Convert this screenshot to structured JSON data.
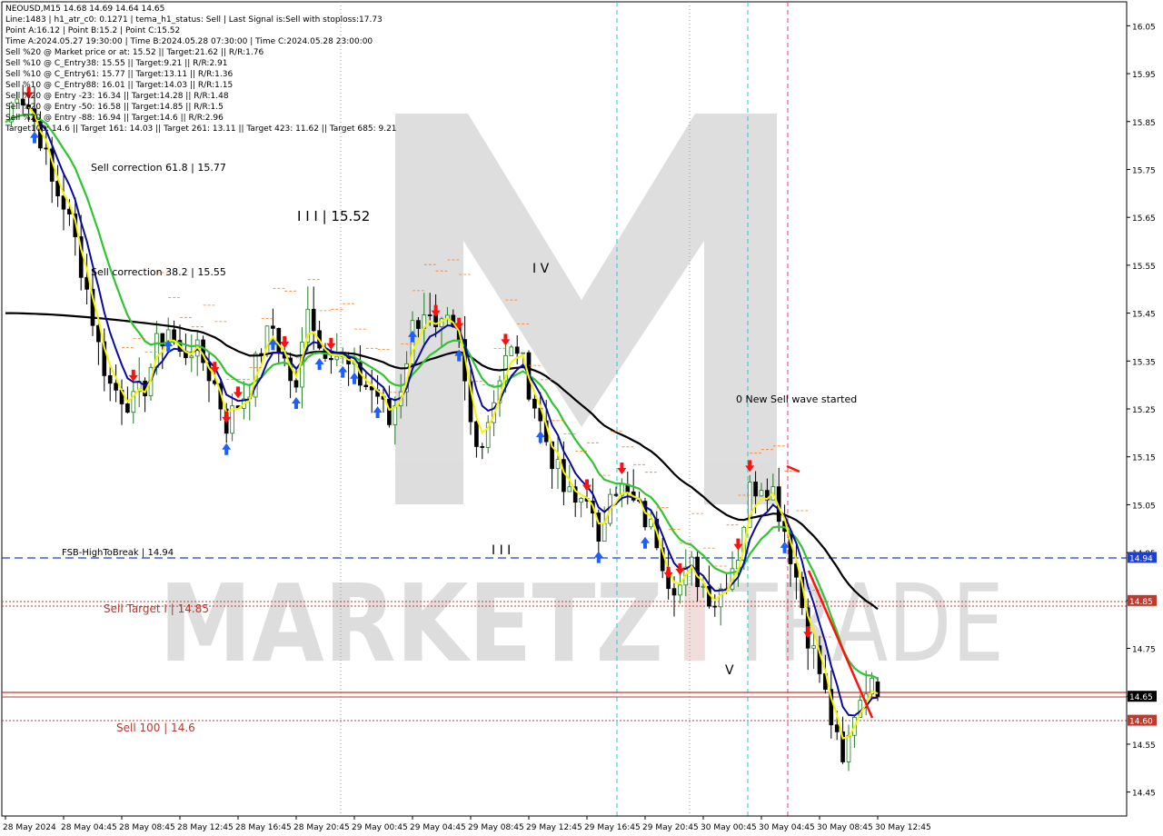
{
  "header": {
    "lines": [
      "NEOUSD,M15  14.68 14.69 14.64 14.65",
      "Line:1483  |  h1_atr_c0: 0.1271  |  tema_h1_status: Sell  |  Last Signal is:Sell with stoploss:17.73",
      "Point A:16.12  |  Point B:15.2  |  Point C:15.52",
      "Time A:2024.05.27 19:30:00  |  Time B:2024.05.28 07:30:00  |  Time C:2024.05.28 23:00:00",
      "Sell %20 @ Market price or at: 15.52  ||  Target:21.62  ||  R/R:1.76",
      "Sell %10 @ C_Entry38: 15.55  ||  Target:9.21  ||  R/R:2.91",
      "Sell %10 @ C_Entry61: 15.77  ||  Target:13.11  ||  R/R:1.36",
      "Sell %10 @ C_Entry88: 16.01  ||  Target:14.03  ||  R/R:1.15",
      "Sell %20 @ Entry -23: 16.34  ||  Target:14.28  ||  R/R:1.48",
      "Sell %20 @ Entry -50: 16.58  ||  Target:14.85  ||  R/R:1.5",
      "Sell %20 @ Entry -88: 16.94  ||  Target:14.6  ||  R/R:2.96",
      "Target100: 14.6  ||  Target 161: 14.03  ||  Target 261: 13.11  ||  Target 423: 11.62  ||  Target 685: 9.21"
    ]
  },
  "watermark": {
    "text_left": "MARKETZ",
    "text_mid": "I",
    "text_right": "TRADE"
  },
  "annotations": {
    "sell_correction_618": "Sell correction 61.8 | 15.77",
    "sell_correction_382": "Sell correction 38.2 | 15.55",
    "wave_III": "I I I | 15.52",
    "wave_IV": "I V",
    "wave_III_low": "I I I",
    "wave_V": "V",
    "new_sell_wave": "0 New Sell wave started",
    "fsb_label": "FSB-HighToBreak | 14.94",
    "sell_target_label": "Sell Target I | 14.85",
    "sell_100_label": "Sell 100 | 14.6"
  },
  "price_tags": [
    {
      "value": "14.94",
      "color": "#1f3fcf"
    },
    {
      "value": "14.85",
      "color": "#c0392b"
    },
    {
      "value": "14.65",
      "color": "#000000"
    },
    {
      "value": "14.60",
      "color": "#c0392b"
    }
  ],
  "colors": {
    "bull": "#1f7a1f",
    "bear": "#000000",
    "ema_slow": "#000000",
    "ema_mid": "#31c431",
    "ema_fast": "#0a0aa0",
    "tema": "#f5f500",
    "arrow_up": "#1f5fff",
    "arrow_down": "#ff1010",
    "fsb": "#1f3fcf",
    "target": "#c0392b",
    "vline_cyan": "#22c8d8",
    "vline_pink": "#e04070"
  },
  "chart_data": {
    "type": "candlestick",
    "symbol": "NEOUSD",
    "timeframe": "M15",
    "ylim": [
      14.4,
      16.1
    ],
    "y_ticks": [
      "16.05",
      "15.95",
      "15.85",
      "15.75",
      "15.65",
      "15.55",
      "15.45",
      "15.35",
      "15.25",
      "15.15",
      "15.05",
      "14.95",
      "14.85",
      "14.75",
      "14.65",
      "14.55",
      "14.45"
    ],
    "x_ticks": [
      "28 May 2024",
      "28 May 04:45",
      "28 May 08:45",
      "28 May 12:45",
      "28 May 16:45",
      "28 May 20:45",
      "29 May 00:45",
      "29 May 04:45",
      "29 May 08:45",
      "29 May 12:45",
      "29 May 16:45",
      "29 May 20:45",
      "30 May 00:45",
      "30 May 04:45",
      "30 May 08:45",
      "30 May 12:45"
    ],
    "levels": {
      "fsb_high_to_break": 14.94,
      "sell_target_1": 14.85,
      "sell_100": 14.6,
      "current": 14.65
    },
    "last_candle": {
      "open": 14.68,
      "high": 14.69,
      "low": 14.64,
      "close": 14.65
    },
    "close_path": [
      [
        0,
        15.85
      ],
      [
        2,
        15.92
      ],
      [
        4,
        15.88
      ],
      [
        6,
        15.82
      ],
      [
        8,
        15.72
      ],
      [
        10,
        15.68
      ],
      [
        12,
        15.6
      ],
      [
        14,
        15.5
      ],
      [
        16,
        15.38
      ],
      [
        18,
        15.3
      ],
      [
        20,
        15.28
      ],
      [
        22,
        15.26
      ],
      [
        24,
        15.3
      ],
      [
        26,
        15.38
      ],
      [
        28,
        15.42
      ],
      [
        30,
        15.36
      ],
      [
        32,
        15.38
      ],
      [
        34,
        15.35
      ],
      [
        36,
        15.3
      ],
      [
        38,
        15.22
      ],
      [
        40,
        15.26
      ],
      [
        42,
        15.3
      ],
      [
        44,
        15.38
      ],
      [
        46,
        15.42
      ],
      [
        48,
        15.35
      ],
      [
        50,
        15.28
      ],
      [
        52,
        15.48
      ],
      [
        54,
        15.38
      ],
      [
        56,
        15.38
      ],
      [
        58,
        15.35
      ],
      [
        60,
        15.32
      ],
      [
        62,
        15.3
      ],
      [
        64,
        15.28
      ],
      [
        66,
        15.22
      ],
      [
        68,
        15.3
      ],
      [
        70,
        15.42
      ],
      [
        72,
        15.46
      ],
      [
        74,
        15.4
      ],
      [
        76,
        15.42
      ],
      [
        78,
        15.38
      ],
      [
        80,
        15.22
      ],
      [
        82,
        15.18
      ],
      [
        84,
        15.28
      ],
      [
        86,
        15.35
      ],
      [
        88,
        15.38
      ],
      [
        90,
        15.3
      ],
      [
        92,
        15.22
      ],
      [
        94,
        15.15
      ],
      [
        96,
        15.08
      ],
      [
        98,
        15.05
      ],
      [
        100,
        15.08
      ],
      [
        102,
        14.95
      ],
      [
        104,
        15.1
      ],
      [
        106,
        15.08
      ],
      [
        108,
        15.05
      ],
      [
        110,
        15.02
      ],
      [
        112,
        14.98
      ],
      [
        114,
        14.9
      ],
      [
        116,
        14.88
      ],
      [
        118,
        14.92
      ],
      [
        120,
        14.88
      ],
      [
        122,
        14.85
      ],
      [
        124,
        14.9
      ],
      [
        126,
        14.95
      ],
      [
        128,
        15.08
      ],
      [
        130,
        15.1
      ],
      [
        132,
        15.08
      ],
      [
        134,
        15.0
      ],
      [
        136,
        14.9
      ],
      [
        138,
        14.78
      ],
      [
        140,
        14.7
      ],
      [
        142,
        14.6
      ],
      [
        144,
        14.5
      ],
      [
        146,
        14.62
      ],
      [
        148,
        14.68
      ],
      [
        150,
        14.65
      ]
    ]
  }
}
